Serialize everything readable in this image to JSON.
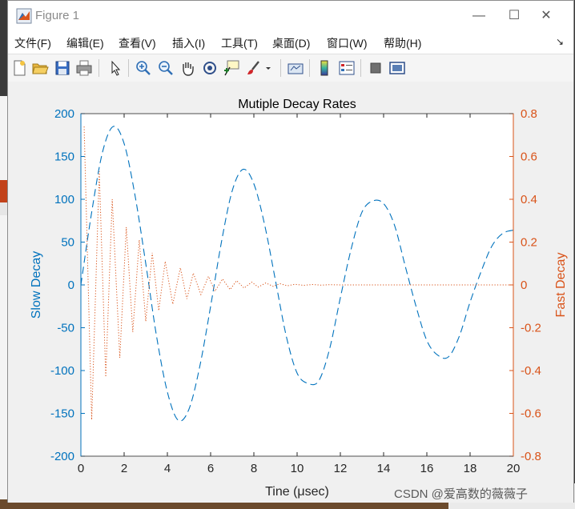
{
  "window": {
    "title": "Figure 1",
    "controls": {
      "minimize": "—",
      "maximize": "☐",
      "close": "✕"
    }
  },
  "menubar": {
    "items": [
      "文件(F)",
      "编辑(E)",
      "查看(V)",
      "插入(I)",
      "工具(T)",
      "桌面(D)",
      "窗口(W)",
      "帮助(H)"
    ],
    "dock_glyph": "↘"
  },
  "toolbar": {
    "icons": [
      "new-figure-icon",
      "open-file-icon",
      "save-icon",
      "print-icon",
      "pointer-icon",
      "zoom-in-icon",
      "zoom-out-icon",
      "pan-hand-icon",
      "rotate-3d-icon",
      "data-cursor-icon",
      "brush-icon",
      "brush-dropdown-icon",
      "link-plot-icon",
      "colorbar-icon",
      "legend-icon",
      "hide-plot-tools-icon",
      "show-plot-tools-icon"
    ]
  },
  "chart_data": {
    "type": "line",
    "title": "Mutiple Decay Rates",
    "xlabel": "Tine (μsec)",
    "ylabel_left": "Slow Decay",
    "ylabel_right": "Fast Decay",
    "xlim": [
      0,
      20
    ],
    "ylim_left": [
      -200,
      200
    ],
    "ylim_right": [
      -0.8,
      0.8
    ],
    "x_ticks": [
      0,
      2,
      4,
      6,
      8,
      10,
      12,
      14,
      16,
      18,
      20
    ],
    "y_ticks_left": [
      -200,
      -150,
      -100,
      -50,
      0,
      50,
      100,
      150,
      200
    ],
    "y_ticks_right": [
      "-0.8",
      "-0.6",
      "-0.4",
      "-0.2",
      "0",
      "0.2",
      "0.4",
      "0.6",
      "0.8"
    ],
    "grid": false,
    "colors": {
      "left_axis": "#0072BD",
      "right_axis": "#D95319"
    },
    "series": [
      {
        "axis": "left",
        "style": "dashed",
        "color": "#0072BD",
        "x": [
          0,
          0.5,
          1.0,
          1.5,
          2.0,
          2.5,
          3.0,
          3.5,
          4.0,
          4.5,
          5.0,
          5.5,
          6.0,
          6.5,
          7.0,
          7.5,
          8.0,
          8.5,
          9.0,
          9.5,
          10.0,
          10.5,
          11.0,
          11.5,
          12.0,
          12.5,
          13.0,
          13.5,
          14.0,
          14.5,
          15.0,
          15.5,
          16.0,
          16.5,
          17.0,
          17.5,
          18.0,
          18.5,
          19.0,
          19.5,
          20.0
        ],
        "y": [
          0,
          85,
          155,
          185,
          165,
          105,
          25,
          -60,
          -125,
          -158,
          -145,
          -95,
          -25,
          50,
          110,
          135,
          118,
          70,
          5,
          -60,
          -103,
          -115,
          -112,
          -75,
          -15,
          42,
          85,
          98,
          95,
          70,
          22,
          -25,
          -65,
          -82,
          -84,
          -60,
          -20,
          15,
          45,
          60,
          64
        ]
      },
      {
        "axis": "right",
        "style": "dotted",
        "color": "#D95319",
        "x": [
          0.15,
          0.5,
          0.85,
          1.15,
          1.45,
          1.8,
          2.1,
          2.4,
          2.7,
          3.0,
          3.3,
          3.6,
          3.9,
          4.25,
          4.6,
          4.9,
          5.2,
          5.55,
          5.9,
          6.2,
          6.55,
          6.9,
          7.2,
          7.55,
          7.9,
          8.2,
          8.55,
          8.9,
          9.2,
          9.55,
          9.9,
          10.3,
          10.7,
          11.1,
          11.5,
          12.0,
          13.0,
          14.0,
          16.0,
          18.0,
          20.0
        ],
        "y": [
          0.74,
          -0.63,
          0.53,
          -0.43,
          0.4,
          -0.34,
          0.27,
          -0.22,
          0.21,
          -0.17,
          0.15,
          -0.12,
          0.11,
          -0.09,
          0.08,
          -0.065,
          0.055,
          -0.045,
          0.04,
          -0.03,
          0.028,
          -0.022,
          0.02,
          -0.015,
          0.013,
          -0.01,
          0.009,
          -0.007,
          0.006,
          -0.004,
          0.003,
          -0.002,
          0.002,
          -0.001,
          0.001,
          0,
          0,
          0,
          0,
          0,
          0
        ]
      }
    ]
  },
  "watermark": "CSDN @爱高数的薇薇子"
}
